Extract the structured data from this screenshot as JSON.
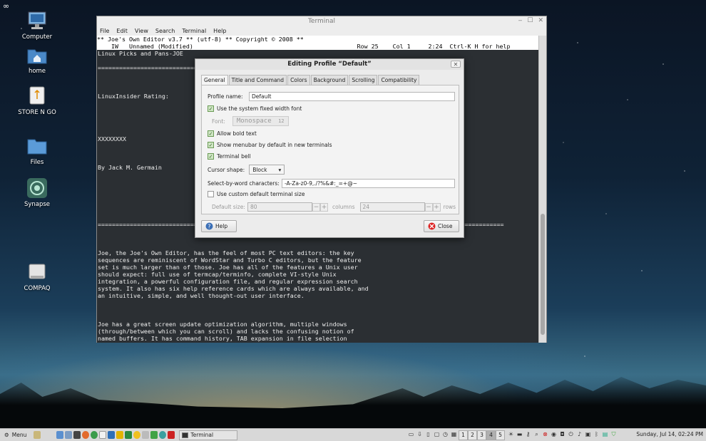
{
  "desktop": {
    "icons": [
      {
        "label": "Computer",
        "icon": "monitor-icon"
      },
      {
        "label": "home",
        "icon": "home-folder-icon"
      },
      {
        "label": "STORE N GO",
        "icon": "usb-drive-icon"
      },
      {
        "label": "Files",
        "icon": "folder-icon"
      },
      {
        "label": "Synapse",
        "icon": "synapse-icon"
      },
      {
        "label": "COMPAQ",
        "icon": "drive-icon"
      }
    ]
  },
  "terminal": {
    "title": "Terminal",
    "menu": [
      "File",
      "Edit",
      "View",
      "Search",
      "Terminal",
      "Help"
    ],
    "lines": {
      "header": "** Joe's Own Editor v3.7 ** (utf-8) ** Copyright © 2008 **",
      "status": "    IW   Unnamed (Modified)                                              Row 25    Col 1     2:24  Ctrl-K H for help",
      "l1": "Linux Picks and Pans-JOE",
      "l2": "==============================",
      "l3": "LinuxInsider Rating:",
      "l4": "XXXXXXXX",
      "l5": "By Jack M. Germain",
      "l6": "==================================================================================================================",
      "p1": "Joe, the Joe's Own Editor, has the feel of most PC text editors: the key\nsequences are reminiscent of WordStar and Turbo C editors, but the feature\nset is much larger than of those. Joe has all of the features a Unix user\nshould expect: full use of termcap/terminfo, complete VI-style Unix\nintegration, a powerful configuration file, and regular expression search\nsystem. It also has six help reference cards which are always available, and\nan intuitive, simple, and well thought-out user interface.",
      "p2": "Joe has a great screen update optimization algorithm, multiple windows\n(through/between which you can scroll) and lacks the confusing notion of\nnamed buffers. It has command history, TAB expansion in file selection"
    }
  },
  "dialog": {
    "title": "Editing Profile “Default”",
    "close_glyph": "✕",
    "tabs": [
      "General",
      "Title and Command",
      "Colors",
      "Background",
      "Scrolling",
      "Compatibility"
    ],
    "profile_name_label": "Profile name:",
    "profile_name_value": "Default",
    "use_system_font_label": "Use the system fixed width font",
    "use_system_font_checked": true,
    "font_label": "Font:",
    "font_name": "Monospace",
    "font_size": "12",
    "allow_bold_label": "Allow bold text",
    "allow_bold_checked": true,
    "show_menubar_label": "Show menubar by default in new terminals",
    "show_menubar_checked": true,
    "terminal_bell_label": "Terminal bell",
    "terminal_bell_checked": true,
    "cursor_shape_label": "Cursor shape:",
    "cursor_shape_value": "Block",
    "select_by_word_label": "Select-by-word characters:",
    "select_by_word_value": "-A-Za-z0-9,./?%&#:_=+@~",
    "custom_size_label": "Use custom default terminal size",
    "custom_size_checked": false,
    "default_size_label": "Default size:",
    "columns_value": "80",
    "columns_label": "columns",
    "rows_value": "24",
    "rows_label": "rows",
    "help_button": "Help",
    "close_button": "Close"
  },
  "taskbar": {
    "menu_label": "Menu",
    "task_label": "Terminal",
    "workspaces": [
      "1",
      "2",
      "3",
      "4",
      "5"
    ],
    "active_workspace": "4",
    "clock": "Sunday, Jul 14, 02:24 PM"
  }
}
